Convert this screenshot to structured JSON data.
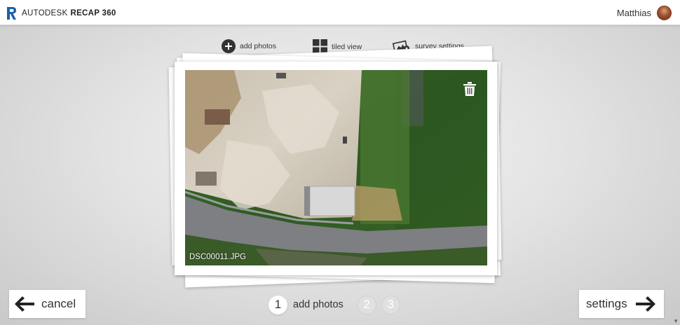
{
  "header": {
    "brand_company": "AUTODESK",
    "brand_product": "RECAP 360",
    "user_name": "Matthias"
  },
  "toolbar": {
    "add_photos": "add photos",
    "tiled_view": "tiled view",
    "survey_settings": "survey settings"
  },
  "photo": {
    "filename": "DSC00011.JPG"
  },
  "nav": {
    "cancel": "cancel",
    "settings": "settings"
  },
  "steps": [
    {
      "number": "1",
      "label": "add photos",
      "active": true
    },
    {
      "number": "2",
      "active": false
    },
    {
      "number": "3",
      "active": false
    }
  ],
  "colors": {
    "brand_blue": "#1a5fa8",
    "toolbar_icon": "#333333",
    "inactive_step": "#e0e0e0"
  }
}
